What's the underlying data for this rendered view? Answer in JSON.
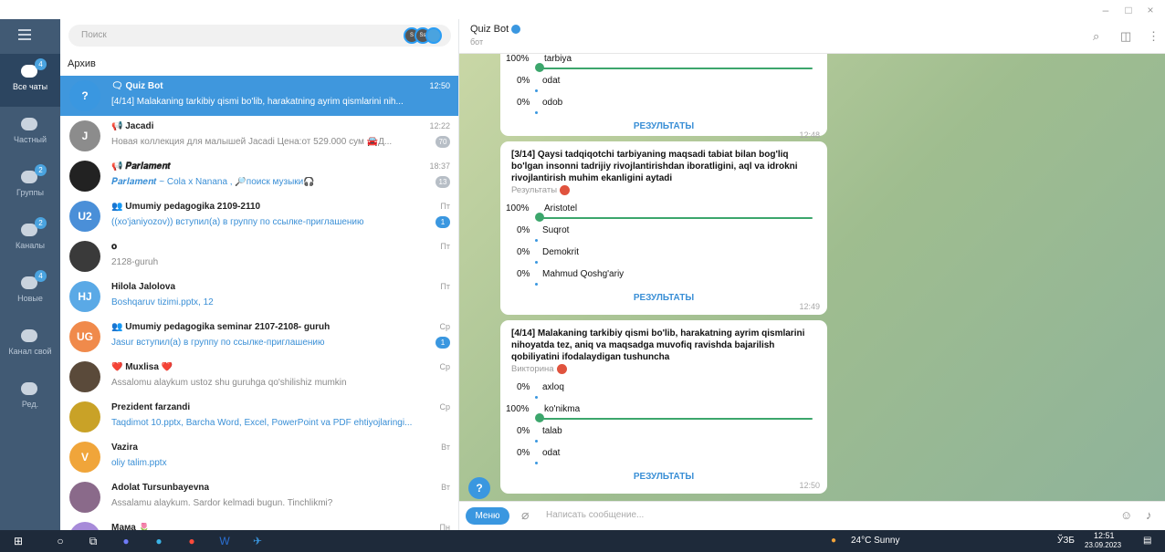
{
  "window": {
    "minimize": "–",
    "maximize": "□",
    "close": "×"
  },
  "rail": {
    "items": [
      {
        "label": "Все чаты",
        "badge": "4",
        "active": true
      },
      {
        "label": "Частный",
        "badge": "",
        "active": false
      },
      {
        "label": "Группы",
        "badge": "2",
        "active": false
      },
      {
        "label": "Каналы",
        "badge": "2",
        "active": false
      },
      {
        "label": "Новые",
        "badge": "4",
        "active": false
      },
      {
        "label": "Канал свой",
        "badge": "",
        "active": false
      },
      {
        "label": "Ред.",
        "badge": "",
        "active": false
      }
    ]
  },
  "search": {
    "placeholder": "Поиск",
    "story1": "S",
    "story2": "Ss"
  },
  "archive_label": "Архив",
  "chats": [
    {
      "name": "🗨 Quiz Bot",
      "time": "12:50",
      "preview": "[4/14] Malakaning tarkibiy qismi bo'lib, harakatning ayrim qismlarini nih...",
      "badge": "",
      "selected": true,
      "avatar_text": "?",
      "avatar_color": "#3a97e0",
      "preview_blue": false
    },
    {
      "name": "📢 Jacadi",
      "time": "12:22",
      "preview": "Новая коллекция для малышей  Jacadi  Цена:от 529.000 сум 🚘Д...",
      "badge": "70",
      "selected": false,
      "avatar_text": "J",
      "avatar_color": "#8c8c8c",
      "preview_blue": false
    },
    {
      "name": "📢 𝑷𝒂𝒓𝒍𝒂𝒎𝒆𝒏𝒕",
      "time": "18:37",
      "preview": "𝑷𝒂𝒓𝒍𝒂𝒎𝒆𝒏𝒕  ~ Cola x Nanana , 🔎поиск музыки🎧",
      "badge": "13",
      "selected": false,
      "avatar_text": "",
      "avatar_color": "#222222",
      "preview_blue": true
    },
    {
      "name": "👥 Umumiy pedagogika 2109-2110",
      "time": "Пт",
      "preview": "((xo'janiyozov)) вступил(а) в группу по ссылке-приглашению",
      "badge": "1",
      "badge_blue": true,
      "selected": false,
      "avatar_text": "U2",
      "avatar_color": "#4a8fd8",
      "preview_blue": true
    },
    {
      "name": "𝐨",
      "time": "Пт",
      "preview": "2128-guruh",
      "badge": "",
      "selected": false,
      "avatar_text": "",
      "avatar_color": "#3a3a3a",
      "preview_blue": false
    },
    {
      "name": "Hilola Jalolova",
      "time": "Пт",
      "preview": "Boshqaruv tizimi.pptx, 12",
      "badge": "",
      "selected": false,
      "avatar_text": "HJ",
      "avatar_color": "#5aa9e6",
      "preview_blue": true
    },
    {
      "name": "👥 Umumiy pedagogika seminar 2107-2108- guruh",
      "time": "Ср",
      "preview": "Jasur вступил(а) в группу по ссылке-приглашению",
      "badge": "1",
      "badge_blue": true,
      "selected": false,
      "avatar_text": "UG",
      "avatar_color": "#f08a4b",
      "preview_blue": true
    },
    {
      "name": "❤️ Muxlisa ❤️",
      "time": "Ср",
      "preview": "Assalomu alaykum ustoz shu guruhga qo'shilishiz mumkin",
      "badge": "",
      "selected": false,
      "avatar_text": "",
      "avatar_color": "#5a4a3a",
      "preview_blue": false
    },
    {
      "name": "Prezident farzandi",
      "time": "Ср",
      "preview": "Taqdimot 10.pptx, Barcha Word, Excel, PowerPoint va PDF ehtiyojlaringi...",
      "badge": "",
      "selected": false,
      "avatar_text": "",
      "avatar_color": "#c9a227",
      "preview_blue": true
    },
    {
      "name": "Vazira",
      "time": "Вт",
      "preview": "oliy talim.pptx",
      "badge": "",
      "selected": false,
      "avatar_text": "V",
      "avatar_color": "#f0a53a",
      "preview_blue": true
    },
    {
      "name": "Adolat Tursunbayevna",
      "time": "Вт",
      "preview": "Assalamu alaykum. Sardor kelmadi bugun. Tinchlikmi?",
      "badge": "",
      "selected": false,
      "avatar_text": "",
      "avatar_color": "#8a6a8a",
      "preview_blue": false
    },
    {
      "name": "Мама 🌷",
      "time": "Пн",
      "preview": "",
      "badge": "",
      "selected": false,
      "avatar_text": "M",
      "avatar_color": "#a78bd9",
      "preview_blue": false
    }
  ],
  "header": {
    "title": "Quiz Bot",
    "subtitle": "бот"
  },
  "messages": [
    {
      "question": "",
      "type": "",
      "options": [
        {
          "pct": "100%",
          "label": "tarbiya",
          "winner": true
        },
        {
          "pct": "0%",
          "label": "odat",
          "winner": false
        },
        {
          "pct": "0%",
          "label": "odob",
          "winner": false
        }
      ],
      "results": "РЕЗУЛЬТАТЫ",
      "time": "12:48"
    },
    {
      "question": "[3/14] Qaysi tadqiqotchi tarbiyaning maqsadi tabiat bilan bog'liq bo'lgan insonni tadrijiy rivojlantirishdan iboratligini, aql va idrokni rivojlantirish muhim ekanligini aytadi",
      "type": "Результаты",
      "options": [
        {
          "pct": "100%",
          "label": "Aristotel",
          "winner": true
        },
        {
          "pct": "0%",
          "label": "Suqrot",
          "winner": false
        },
        {
          "pct": "0%",
          "label": "Demokrit",
          "winner": false
        },
        {
          "pct": "0%",
          "label": "Mahmud Qoshg'ariy",
          "winner": false
        }
      ],
      "results": "РЕЗУЛЬТАТЫ",
      "time": "12:49"
    },
    {
      "question": "[4/14] Malakaning tarkibiy qismi bo'lib, harakatning ayrim qismlarini nihoyatda tez, aniq va maqsadga muvofiq ravishda bajarilish qobiliyatini ifodalaydigan tushuncha",
      "type": "Викторина",
      "options": [
        {
          "pct": "0%",
          "label": "axloq",
          "winner": false
        },
        {
          "pct": "100%",
          "label": "ko'nikma",
          "winner": true
        },
        {
          "pct": "0%",
          "label": "talab",
          "winner": false
        },
        {
          "pct": "0%",
          "label": "odat",
          "winner": false
        }
      ],
      "results": "РЕЗУЛЬТАТЫ",
      "time": "12:50"
    }
  ],
  "composer": {
    "menu": "Меню",
    "placeholder": "Написать сообщение..."
  },
  "taskbar": {
    "weather": "24°C  Sunny",
    "lang": "ЎЗБ",
    "time": "12:51",
    "date": "23.09.2023",
    "telegram_badge": "433"
  },
  "colors": {
    "accent": "#3a97e0",
    "rail": "#415a74",
    "winner": "#3ca66c"
  }
}
